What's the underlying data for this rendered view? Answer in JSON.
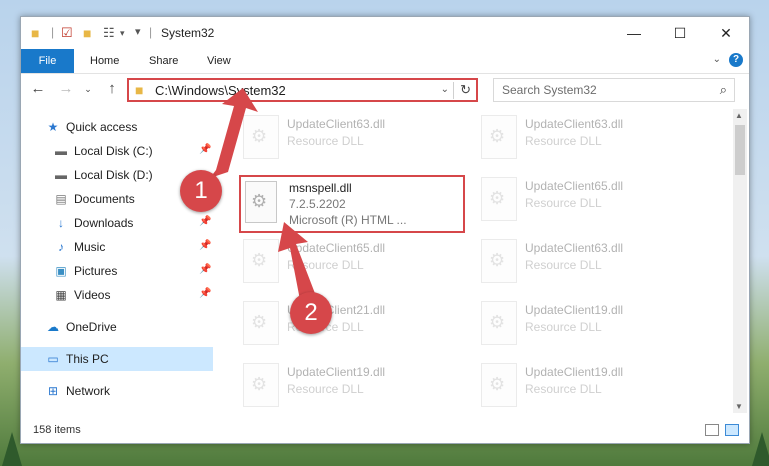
{
  "window": {
    "title": "System32",
    "controls": {
      "minimize": "—",
      "maximize": "☐",
      "close": "✕"
    }
  },
  "ribbon": {
    "tabs": [
      "File",
      "Home",
      "Share",
      "View"
    ],
    "help": "?"
  },
  "address": {
    "path": "C:\\Windows\\System32",
    "search_placeholder": "Search System32"
  },
  "nav": {
    "items": [
      {
        "label": "Quick access",
        "icon": "star-icon"
      },
      {
        "label": "Local Disk (C:)",
        "icon": "drive-icon",
        "pinned": true
      },
      {
        "label": "Local Disk (D:)",
        "icon": "drive-icon"
      },
      {
        "label": "Documents",
        "icon": "document-icon",
        "pinned": true
      },
      {
        "label": "Downloads",
        "icon": "download-icon",
        "pinned": true
      },
      {
        "label": "Music",
        "icon": "music-icon",
        "pinned": true
      },
      {
        "label": "Pictures",
        "icon": "picture-icon",
        "pinned": true
      },
      {
        "label": "Videos",
        "icon": "video-icon",
        "pinned": true
      },
      {
        "label": "OneDrive",
        "icon": "cloud-icon"
      },
      {
        "label": "This PC",
        "icon": "computer-icon",
        "selected": true
      },
      {
        "label": "Network",
        "icon": "network-icon"
      }
    ]
  },
  "files": {
    "highlighted": {
      "name": "msnspell.dll",
      "version": "7.2.5.2202",
      "company": "Microsoft (R) HTML ..."
    },
    "background": [
      {
        "name": "UpdateClient63.dll",
        "type": "Resource DLL"
      },
      {
        "name": "UpdateClient63.dll",
        "type": "Resource DLL"
      },
      {
        "name": "UpdateClient65.dll",
        "type": "Resource DLL"
      },
      {
        "name": "UpdateClient65.dll",
        "type": "Resource DLL"
      },
      {
        "name": "UpdateClient63.dll",
        "type": "Resource DLL"
      },
      {
        "name": "UpdateClient21.dll",
        "type": "Resource DLL"
      },
      {
        "name": "UpdateClient19.dll",
        "type": "Resource DLL"
      },
      {
        "name": "UpdateClient19.dll",
        "type": "Resource DLL"
      },
      {
        "name": "UpdateClient19.dll",
        "type": "Resource DLL"
      }
    ]
  },
  "status": {
    "item_count": "158 items"
  },
  "callouts": {
    "one": "1",
    "two": "2"
  },
  "colors": {
    "accent": "#1979ca",
    "highlight": "#d6474a",
    "selection": "#cce8ff"
  }
}
